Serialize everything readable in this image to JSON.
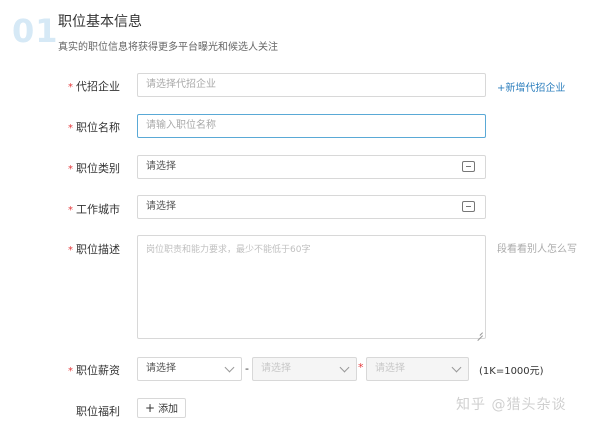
{
  "step": {
    "number": "01",
    "title": "职位基本信息",
    "subtitle": "真实的职位信息将获得更多平台曝光和候选人关注"
  },
  "required_mark": "*",
  "form": {
    "company": {
      "label": "代招企业",
      "placeholder": "请选择代招企业",
      "add_link": "+新增代招企业"
    },
    "job_name": {
      "label": "职位名称",
      "placeholder": "请输入职位名称"
    },
    "job_category": {
      "label": "职位类别",
      "value": "请选择"
    },
    "work_city": {
      "label": "工作城市",
      "value": "请选择"
    },
    "description": {
      "label": "职位描述",
      "placeholder": "岗位职责和能力要求，最少不能低于60字",
      "side_hint": "段看看别人怎么写"
    },
    "salary": {
      "label": "职位薪资",
      "min_value": "请选择",
      "max_value": "请选择",
      "months_value": "请选择",
      "dash": "-",
      "times": "*",
      "unit_hint": "(1K=1000元)"
    },
    "benefits": {
      "label": "职位福利",
      "add_label": "添加",
      "add_icon": "plus-icon"
    }
  },
  "watermark": "知乎 @猎头杂谈",
  "colors": {
    "accent": "#2d7fbe",
    "required": "#e4393c",
    "step_number": "#d6e9f6",
    "focus_border": "#5aa9d6"
  }
}
